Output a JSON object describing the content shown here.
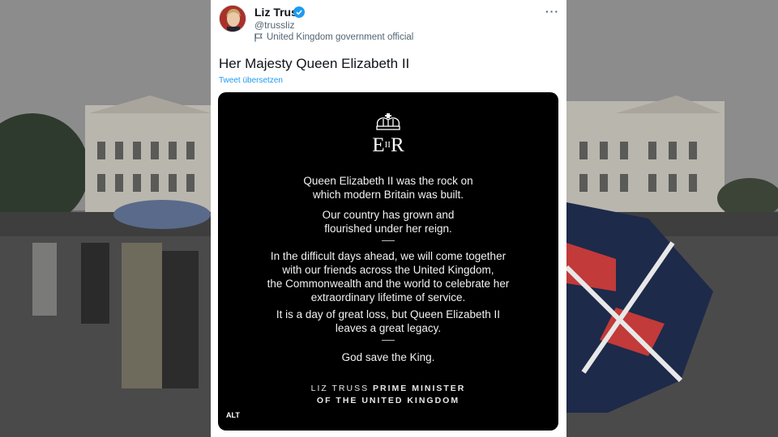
{
  "tweet": {
    "author_name": "Liz Truss",
    "handle": "@trussliz",
    "gov_label": "United Kingdom government official",
    "more_label": "···",
    "text": "Her Majesty Queen Elizabeth II",
    "translate_label": "Tweet übersetzen",
    "verified_color": "#1d9bf0"
  },
  "image": {
    "cipher": "EIIR",
    "paragraphs": [
      "Queen Elizabeth II was the rock on\nwhich modern Britain was built.",
      "Our country has grown and\nflourished under her reign.",
      "In the difficult days ahead, we will come together\nwith our friends across the United Kingdom,\nthe Commonwealth and the world to celebrate her\nextraordinary lifetime of service.",
      "It is a day of great loss, but Queen Elizabeth II\nleaves a great legacy.",
      "God save the King."
    ],
    "signature_name": "LIZ TRUSS",
    "signature_title_line1": "PRIME MINISTER",
    "signature_title_line2": "OF THE UNITED KINGDOM",
    "alt_label": "ALT"
  }
}
